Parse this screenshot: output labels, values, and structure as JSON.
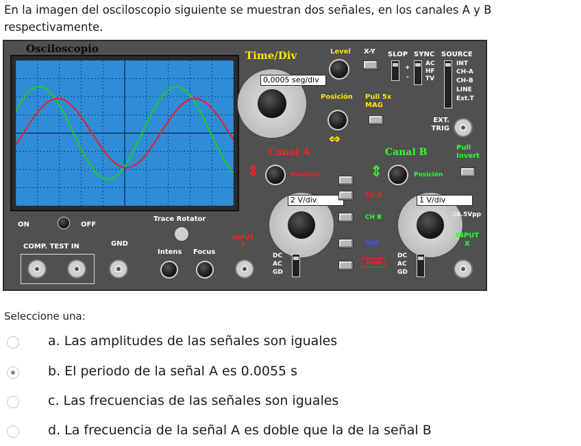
{
  "question": "En la imagen del osciloscopio siguiente se muestran dos señales, en los canales A y B respectivamente.",
  "oscilloscope": {
    "title": "Osciloscopio",
    "time_div_label": "Time/Div",
    "time_div_value": "0,0005 seg/div",
    "level_label": "Level",
    "xy_label": "X-Y",
    "slop_label": "SLOP",
    "sync_label": "SYNC",
    "source_label": "SOURCE",
    "sync_options": [
      "AC",
      "HF",
      "TV"
    ],
    "source_options": [
      "INT",
      "CH-A",
      "CH-B",
      "LINE",
      "Ext.T"
    ],
    "posicion_label": "Posición",
    "pull_mag_label": "Pull 5x MAG",
    "ext_trig_label": "EXT. TRIG",
    "canal_a_label": "Canal A",
    "canal_b_label": "Canal B",
    "canal_a_posicion": "Posición",
    "canal_b_posicion": "Posición",
    "pull_invert_label": "Pull Invert",
    "ch_a_volts_div": "2 V/div",
    "ch_b_volts_div": "1 V/div",
    "ch_a_button": "CH A",
    "ch_b_button": "CH B",
    "add_button": "Add",
    "dual_button": "Dual",
    "on_label": "ON",
    "off_label": "OFF",
    "trace_rotator_label": "Trace Rotator",
    "comp_test_in_label": "COMP. TEST IN",
    "gnd_label": "GND",
    "intens_label": "Intens",
    "focus_label": "Focus",
    "input_y_label": "INPUT Y",
    "input_x_label": "INPUT X",
    "cal_label": "⎍0.5Vpp",
    "coupling_a": [
      "DC",
      "AC",
      "GD"
    ],
    "coupling_b": [
      "DC",
      "AC",
      "GD"
    ],
    "colors": {
      "channel_a": "#e0242b",
      "channel_b": "#22c82a",
      "screen_bg": "#2f8dd8",
      "grid": "#0a3a6a"
    }
  },
  "prompt": "Seleccione una:",
  "options": [
    {
      "label": "a. Las amplitudes de las señales son iguales",
      "selected": false
    },
    {
      "label": "b. El periodo de la señal A es 0.0055 s",
      "selected": true
    },
    {
      "label": "c. Las frecuencias de las señales son iguales",
      "selected": false
    },
    {
      "label": "d. La frecuencia de la señal A es doble que la de la señal B",
      "selected": false
    }
  ]
}
